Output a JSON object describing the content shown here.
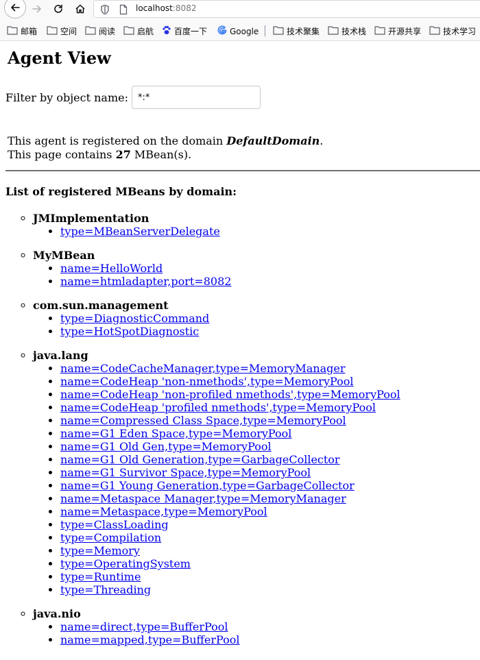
{
  "browser": {
    "url_host": "localhost",
    "url_port": ":8082",
    "bookmarks": [
      {
        "label": "邮箱",
        "icon": "folder-icon"
      },
      {
        "label": "空间",
        "icon": "folder-icon"
      },
      {
        "label": "阅读",
        "icon": "folder-icon"
      },
      {
        "label": "启航",
        "icon": "folder-icon"
      },
      {
        "label": "百度一下",
        "icon": "baidu-paw-icon"
      },
      {
        "label": "Google",
        "icon": "google-icon"
      },
      {
        "label": "技术聚集",
        "icon": "folder-icon"
      },
      {
        "label": "技术栈",
        "icon": "folder-icon"
      },
      {
        "label": "开源共享",
        "icon": "folder-icon"
      },
      {
        "label": "技术学习",
        "icon": "folder-icon"
      }
    ]
  },
  "page": {
    "title": "Agent View",
    "filter_label": "Filter by object name:",
    "filter_value": "*:*",
    "domain_prefix": "This agent is registered on the domain ",
    "domain_name": "DefaultDomain",
    "domain_suffix": ".",
    "count_prefix": "This page contains ",
    "count": "27",
    "count_suffix": " MBean(s).",
    "list_heading": "List of registered MBeans by domain:",
    "domains": [
      {
        "name": "JMImplementation",
        "beans": [
          "type=MBeanServerDelegate"
        ]
      },
      {
        "name": "MyMBean",
        "beans": [
          "name=HelloWorld",
          "name=htmladapter,port=8082"
        ]
      },
      {
        "name": "com.sun.management",
        "beans": [
          "type=DiagnosticCommand",
          "type=HotSpotDiagnostic"
        ]
      },
      {
        "name": "java.lang",
        "beans": [
          "name=CodeCacheManager,type=MemoryManager",
          "name=CodeHeap 'non-nmethods',type=MemoryPool",
          "name=CodeHeap 'non-profiled nmethods',type=MemoryPool",
          "name=CodeHeap 'profiled nmethods',type=MemoryPool",
          "name=Compressed Class Space,type=MemoryPool",
          "name=G1 Eden Space,type=MemoryPool",
          "name=G1 Old Gen,type=MemoryPool",
          "name=G1 Old Generation,type=GarbageCollector",
          "name=G1 Survivor Space,type=MemoryPool",
          "name=G1 Young Generation,type=GarbageCollector",
          "name=Metaspace Manager,type=MemoryManager",
          "name=Metaspace,type=MemoryPool",
          "type=ClassLoading",
          "type=Compilation",
          "type=Memory",
          "type=OperatingSystem",
          "type=Runtime",
          "type=Threading"
        ]
      },
      {
        "name": "java.nio",
        "beans": [
          "name=direct,type=BufferPool",
          "name=mapped,type=BufferPool"
        ]
      }
    ]
  },
  "colors": {
    "link": "#0000ee",
    "rule": "#707070"
  }
}
